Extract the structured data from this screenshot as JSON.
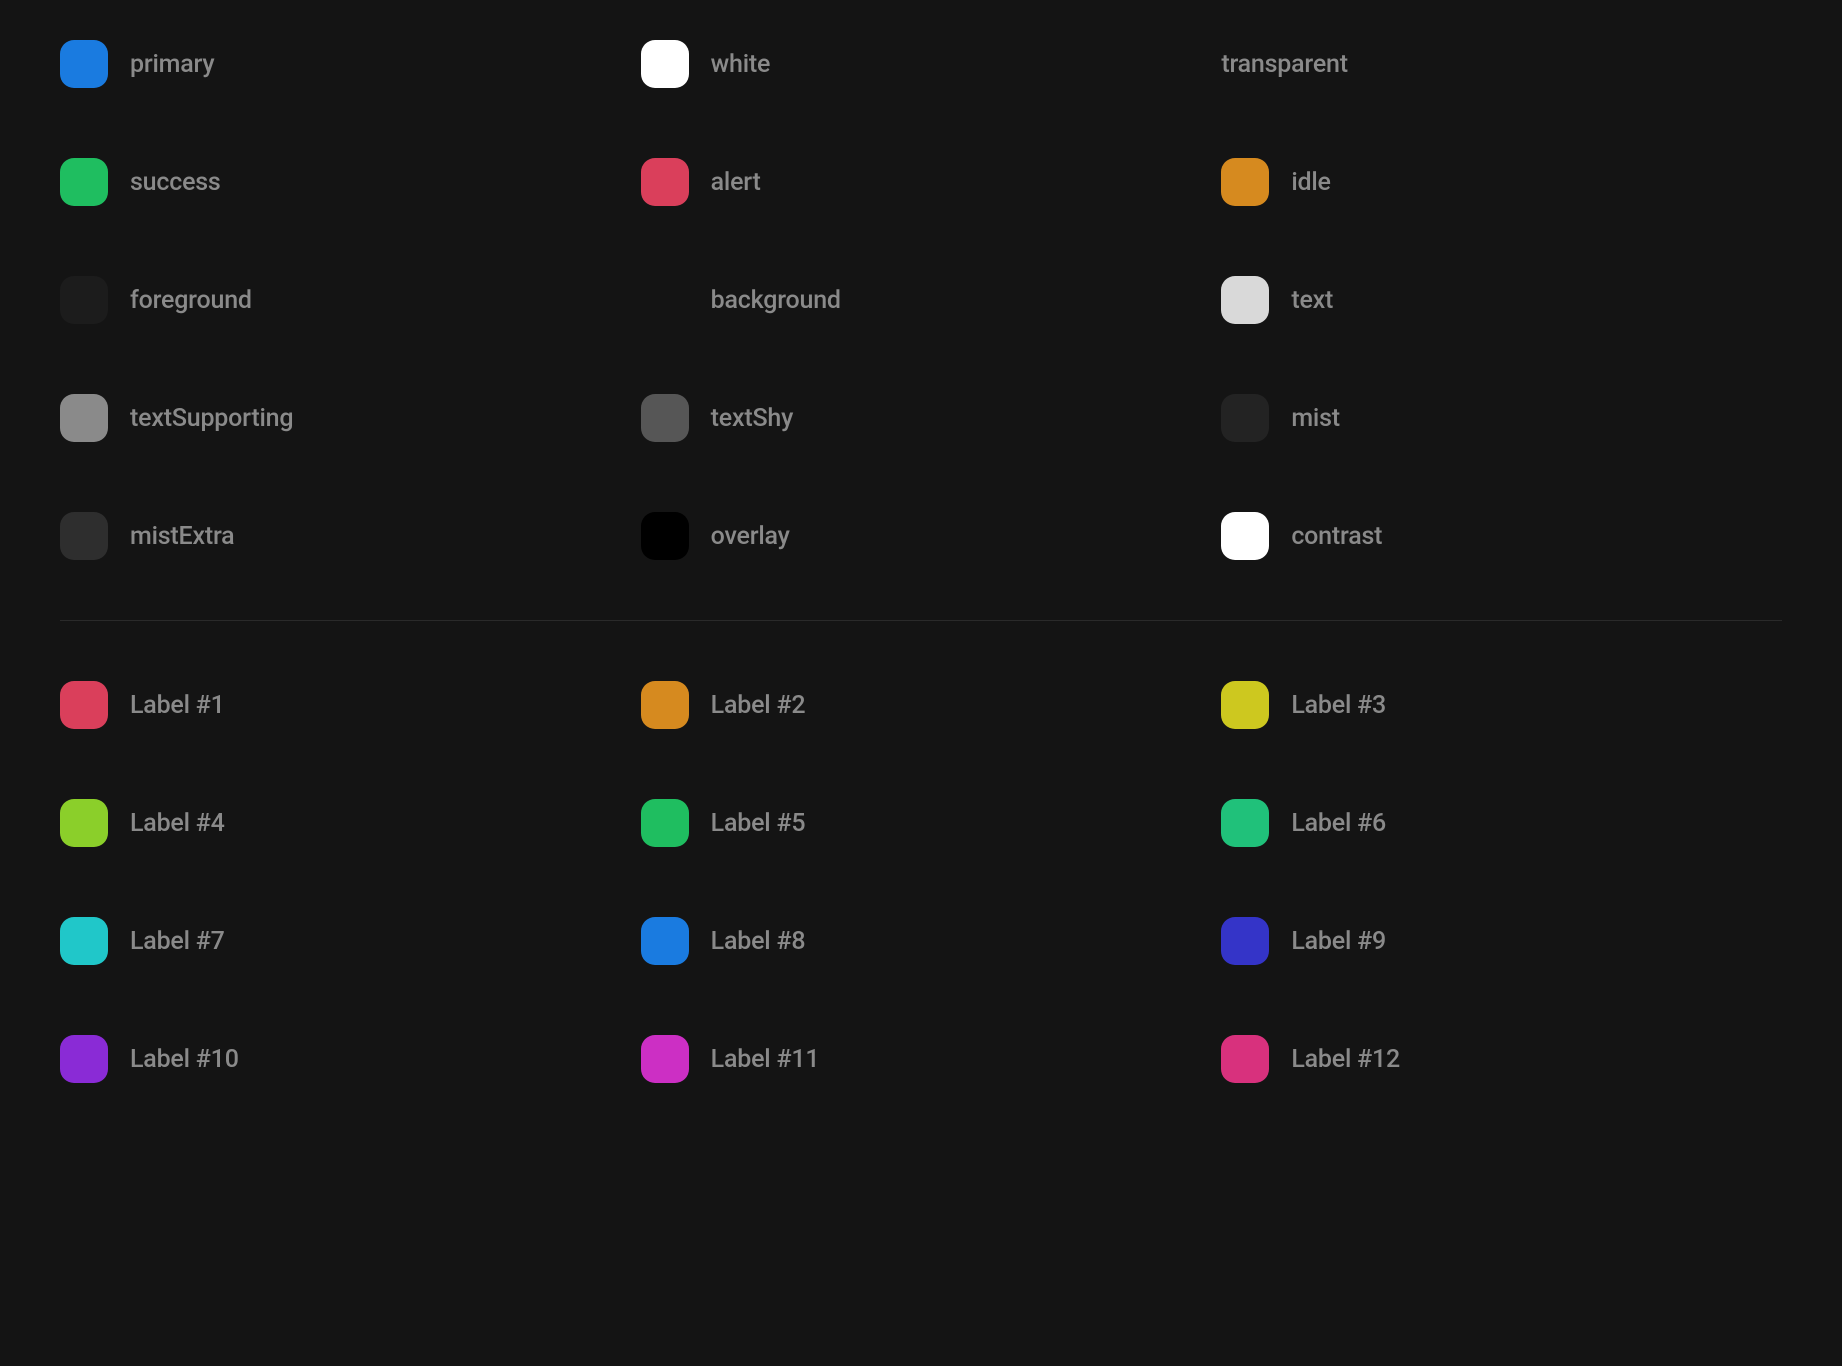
{
  "semantic": [
    {
      "name": "primary",
      "label": "primary",
      "color": "#1a7be0",
      "showChip": true
    },
    {
      "name": "white",
      "label": "white",
      "color": "#ffffff",
      "showChip": true
    },
    {
      "name": "transparent",
      "label": "transparent",
      "color": "",
      "showChip": false,
      "alignRight": true
    },
    {
      "name": "success",
      "label": "success",
      "color": "#1fbe60",
      "showChip": true
    },
    {
      "name": "alert",
      "label": "alert",
      "color": "#da3f5b",
      "showChip": true
    },
    {
      "name": "idle",
      "label": "idle",
      "color": "#d68a1f",
      "showChip": true
    },
    {
      "name": "foreground",
      "label": "foreground",
      "color": "#1c1c1c",
      "showChip": true
    },
    {
      "name": "background",
      "label": "background",
      "color": "",
      "showChip": false
    },
    {
      "name": "text",
      "label": "text",
      "color": "#d9d9d9",
      "showChip": true
    },
    {
      "name": "textSupporting",
      "label": "textSupporting",
      "color": "#8a8a8a",
      "showChip": true
    },
    {
      "name": "textShy",
      "label": "textShy",
      "color": "#565656",
      "showChip": true
    },
    {
      "name": "mist",
      "label": "mist",
      "color": "#232323",
      "showChip": true
    },
    {
      "name": "mistExtra",
      "label": "mistExtra",
      "color": "#2e2e2e",
      "showChip": true
    },
    {
      "name": "overlay",
      "label": "overlay",
      "color": "#000000",
      "showChip": true
    },
    {
      "name": "contrast",
      "label": "contrast",
      "color": "#ffffff",
      "showChip": true
    }
  ],
  "labels": [
    {
      "name": "label-1",
      "label": "Label #1",
      "color": "#da3f5b"
    },
    {
      "name": "label-2",
      "label": "Label #2",
      "color": "#d68a1f"
    },
    {
      "name": "label-3",
      "label": "Label #3",
      "color": "#cdc81f"
    },
    {
      "name": "label-4",
      "label": "Label #4",
      "color": "#8bcf2a"
    },
    {
      "name": "label-5",
      "label": "Label #5",
      "color": "#1fbe60"
    },
    {
      "name": "label-6",
      "label": "Label #6",
      "color": "#20c17a"
    },
    {
      "name": "label-7",
      "label": "Label #7",
      "color": "#20c7c9"
    },
    {
      "name": "label-8",
      "label": "Label #8",
      "color": "#1a7be0"
    },
    {
      "name": "label-9",
      "label": "Label #9",
      "color": "#3434c8"
    },
    {
      "name": "label-10",
      "label": "Label #10",
      "color": "#8a2bd6"
    },
    {
      "name": "label-11",
      "label": "Label #11",
      "color": "#cc2fc4"
    },
    {
      "name": "label-12",
      "label": "Label #12",
      "color": "#d8317d"
    }
  ]
}
